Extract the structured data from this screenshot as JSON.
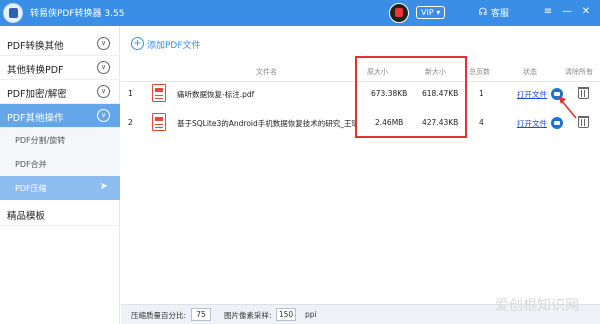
{
  "window": {
    "title": "转易侠PDF转换器 3.55",
    "vip_label": "VIP",
    "service_label": "客服",
    "minimize_glyph": "—",
    "close_glyph": "✕",
    "menu_glyph": "≡",
    "vip_dropdown_glyph": "▾",
    "service_icon": "headset-icon"
  },
  "sidebar": {
    "items": [
      {
        "label": "PDF转换其他",
        "chev": "∨"
      },
      {
        "label": "其他转换PDF",
        "chev": "∨"
      },
      {
        "label": "PDF加密/解密",
        "chev": "∨"
      },
      {
        "label": "PDF其他操作",
        "chev": "∨"
      }
    ],
    "subitems": [
      {
        "label": "PDF分割/旋转"
      },
      {
        "label": "PDF合并"
      },
      {
        "label": "PDF压缩",
        "arrow": "➤"
      }
    ],
    "last_item": {
      "label": "精品模板"
    }
  },
  "main": {
    "add_label": "添加PDF文件",
    "add_glyph": "+",
    "columns": [
      "文件名",
      "原大小",
      "新大小",
      "总页数",
      "状态",
      "清除所有"
    ],
    "rows": [
      {
        "index": "1",
        "filename": "痛听数据恢复-标注.pdf",
        "orig_size": "673.38KB",
        "new_size": "618.47KB",
        "pages": "1",
        "status_link": "打开文件"
      },
      {
        "index": "2",
        "filename": "基于SQLite3的Android手机数据恢复技术的研究_王瑶...",
        "orig_size": "2.46MB",
        "new_size": "427.43KB",
        "pages": "4",
        "status_link": "打开文件"
      }
    ]
  },
  "footer": {
    "quality_label": "压缩质量百分比:",
    "quality_value": "75",
    "sample_label": "图片像素采样:",
    "sample_value": "150",
    "sample_unit": "ppi"
  },
  "watermark": "爱创根知识网",
  "colors": {
    "accent": "#3a8ee6",
    "sidebar_active": "#65a6ea",
    "highlight": "#e23232"
  }
}
